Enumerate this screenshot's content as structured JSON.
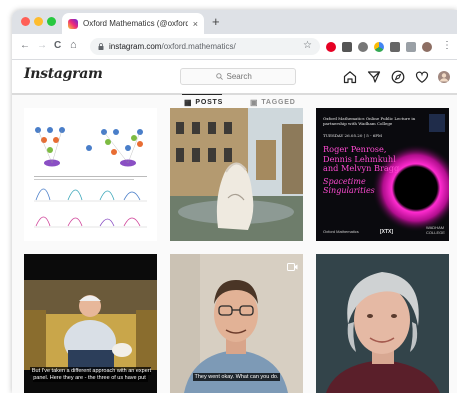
{
  "browser": {
    "tab_title": "Oxford Mathematics (@oxford...",
    "tab_close": "×",
    "new_tab": "+",
    "url_host": "instagram.com",
    "url_path": "/oxford.mathematics/",
    "nav_back": "←",
    "nav_forward": "→",
    "nav_reload": "C",
    "nav_home": "⌂",
    "bookmark_star": "☆"
  },
  "instagram": {
    "logo": "Instagram",
    "search_placeholder": "Search",
    "tabs": [
      {
        "label": "POSTS",
        "glyph": "▦"
      },
      {
        "label": "TAGGED",
        "glyph": "▣"
      }
    ]
  },
  "posts": {
    "poster": {
      "header": "Oxford Mathematics Online Public Lecture in partnership with Wadham College",
      "date": "TUESDAY 26.05.20 | 5 - 6PM",
      "speakers": "Roger Penrose, Dennis Lehmkuhl and Melvyn Bragg",
      "talk": "Spacetime Singularities",
      "footer_left": "Oxford Mathematics",
      "footer_mid": "[XTX]",
      "footer_right": "WADHAM COLLEGE"
    },
    "video1_subtitle": "But I've taken a different approach with an expert panel. Here they are - the three of us have put",
    "video2_subtitle": "They went okay. What can you do."
  },
  "colors": {
    "accent": "#262626",
    "poster_pink": "#ff4bd2",
    "border": "#dbdbdb"
  }
}
